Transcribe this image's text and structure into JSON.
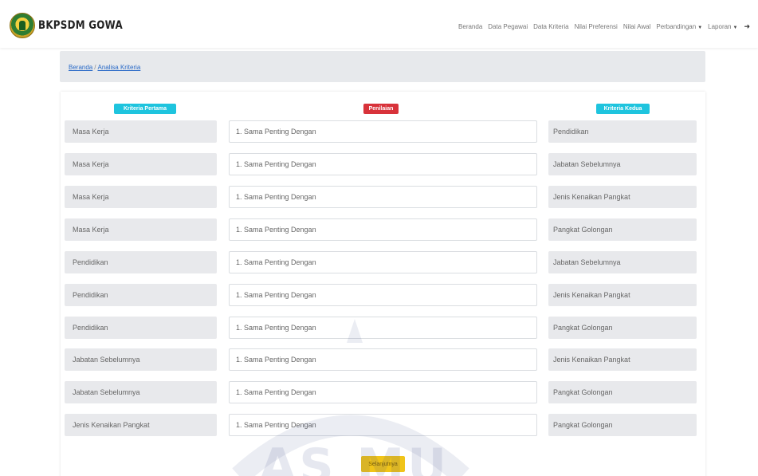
{
  "app": {
    "name": "BKPSDM GOWA"
  },
  "nav": {
    "items": [
      {
        "label": "Beranda",
        "dropdown": false
      },
      {
        "label": "Data Pegawai",
        "dropdown": false
      },
      {
        "label": "Data Kriteria",
        "dropdown": false
      },
      {
        "label": "Nilai Preferensi",
        "dropdown": false
      },
      {
        "label": "Nilai Awal",
        "dropdown": false
      },
      {
        "label": "Perbandingan",
        "dropdown": true
      },
      {
        "label": "Laporan",
        "dropdown": true
      }
    ],
    "logout_icon": "logout-icon"
  },
  "breadcrumb": {
    "home": "Beranda",
    "separator": "/",
    "current": "Analisa Kriteria"
  },
  "headers": {
    "left": "Kriteria Pertama",
    "middle": "Penilaian",
    "right": "Kriteria Kedua"
  },
  "rows": [
    {
      "left": "Masa Kerja",
      "value": "1. Sama Penting Dengan",
      "right": "Pendidikan"
    },
    {
      "left": "Masa Kerja",
      "value": "1. Sama Penting Dengan",
      "right": "Jabatan Sebelumnya"
    },
    {
      "left": "Masa Kerja",
      "value": "1. Sama Penting Dengan",
      "right": "Jenis Kenaikan Pangkat"
    },
    {
      "left": "Masa Kerja",
      "value": "1. Sama Penting Dengan",
      "right": "Pangkat Golongan"
    },
    {
      "left": "Pendidikan",
      "value": "1. Sama Penting Dengan",
      "right": "Jabatan Sebelumnya"
    },
    {
      "left": "Pendidikan",
      "value": "1. Sama Penting Dengan",
      "right": "Jenis Kenaikan Pangkat"
    },
    {
      "left": "Pendidikan",
      "value": "1. Sama Penting Dengan",
      "right": "Pangkat Golongan"
    },
    {
      "left": "Jabatan Sebelumnya",
      "value": "1. Sama Penting Dengan",
      "right": "Jenis Kenaikan Pangkat"
    },
    {
      "left": "Jabatan Sebelumnya",
      "value": "1. Sama Penting Dengan",
      "right": "Pangkat Golongan"
    },
    {
      "left": "Jenis Kenaikan Pangkat",
      "value": "1. Sama Penting Dengan",
      "right": "Pangkat Golongan"
    }
  ],
  "submit": {
    "label": "Selanjutnya"
  },
  "watermark": {
    "text": "AS MU"
  },
  "colors": {
    "info": "#1ec4de",
    "danger": "#d8323a",
    "warning": "#f0c419",
    "link": "#2a6ac7"
  }
}
